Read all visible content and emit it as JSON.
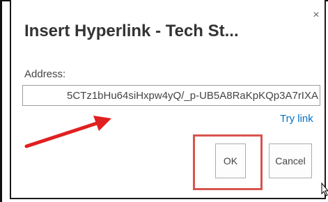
{
  "dialog": {
    "title": "Insert Hyperlink - Tech St...",
    "close_label": "×",
    "address_label": "Address:",
    "address_value": "5CTz1bHu64siHxpw4yQ/_p-UB5A8RaKpKQp3A7rIXA",
    "try_link_label": "Try link",
    "ok_label": "OK",
    "cancel_label": "Cancel"
  },
  "annotations": {
    "arrow_color": "#e02020",
    "highlight_color": "#d9534f",
    "arrow_icon": "red-arrow-icon"
  },
  "colors": {
    "link": "#0072c6",
    "text": "#444444",
    "title": "#333333"
  }
}
